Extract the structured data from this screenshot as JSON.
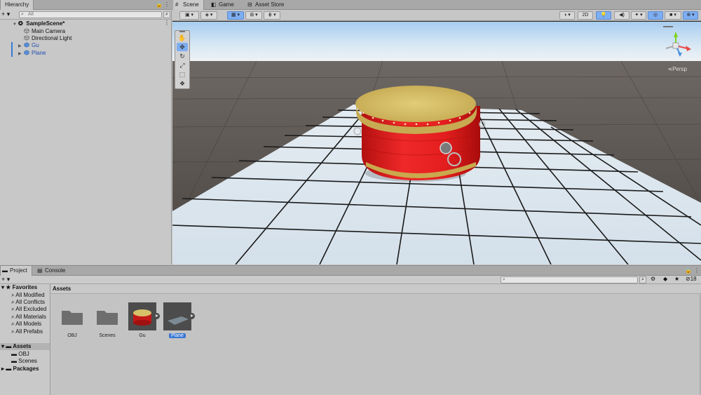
{
  "hierarchy": {
    "tab": "Hierarchy",
    "add_label": "+ ▾",
    "search_placeholder": "All",
    "scene_name": "SampleScene*",
    "items": [
      {
        "label": "Main Camera"
      },
      {
        "label": "Directional Light"
      },
      {
        "label": "Gu"
      },
      {
        "label": "Plane"
      }
    ]
  },
  "scene": {
    "tabs": [
      {
        "label": "Scene"
      },
      {
        "label": "Game"
      },
      {
        "label": "Asset Store"
      }
    ],
    "toolbar": {
      "mode_2d": "2D"
    },
    "persp_label": "Persp"
  },
  "project": {
    "tabs": [
      {
        "label": "Project"
      },
      {
        "label": "Console"
      }
    ],
    "add_label": "+ ▾",
    "badge_count": "18",
    "favorites": {
      "label": "Favorites",
      "items": [
        {
          "label": "All Modified"
        },
        {
          "label": "All Conflicts"
        },
        {
          "label": "All Excluded"
        },
        {
          "label": "All Materials"
        },
        {
          "label": "All Models"
        },
        {
          "label": "All Prefabs"
        }
      ]
    },
    "assets_tree": {
      "label": "Assets",
      "children": [
        {
          "label": "OBJ"
        },
        {
          "label": "Scenes"
        }
      ]
    },
    "packages_label": "Packages",
    "assets_header": "Assets",
    "assets": [
      {
        "label": "OBJ",
        "kind": "folder"
      },
      {
        "label": "Scenes",
        "kind": "folder"
      },
      {
        "label": "Gu",
        "kind": "model"
      },
      {
        "label": "Plane",
        "kind": "model"
      }
    ]
  },
  "colors": {
    "accent": "#3a77d3",
    "drum_body": "#e02020",
    "drum_head": "#d6c06a"
  }
}
